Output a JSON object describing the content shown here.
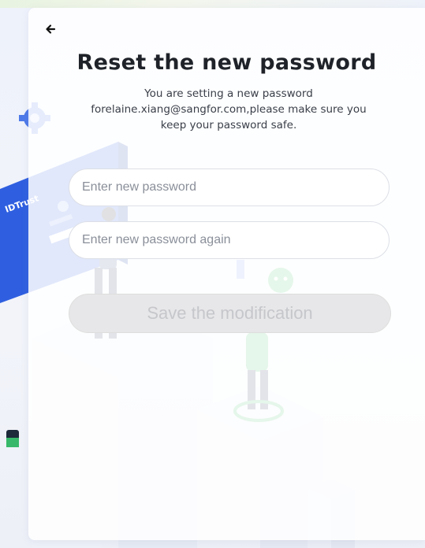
{
  "page": {
    "back_icon": "arrow-left-icon",
    "title": "Reset the new password",
    "subtitle_lines": [
      "You are setting a new password",
      "forelaine.xiang@sangfor.com,please make sure you",
      "keep your password safe."
    ]
  },
  "form": {
    "new_password_placeholder": "Enter new password",
    "confirm_password_placeholder": "Enter new password again",
    "new_password_value": "",
    "confirm_password_value": "",
    "save_label": "Save the modification",
    "save_disabled": true
  },
  "illustration": {
    "card_text": "IDTrust"
  },
  "colors": {
    "title": "#1f2329",
    "button_disabled_bg": "#e7e7e9",
    "button_disabled_text": "#c6c7cb",
    "accent_blue": "#2f5fe0",
    "accent_green": "#4cc46a"
  }
}
